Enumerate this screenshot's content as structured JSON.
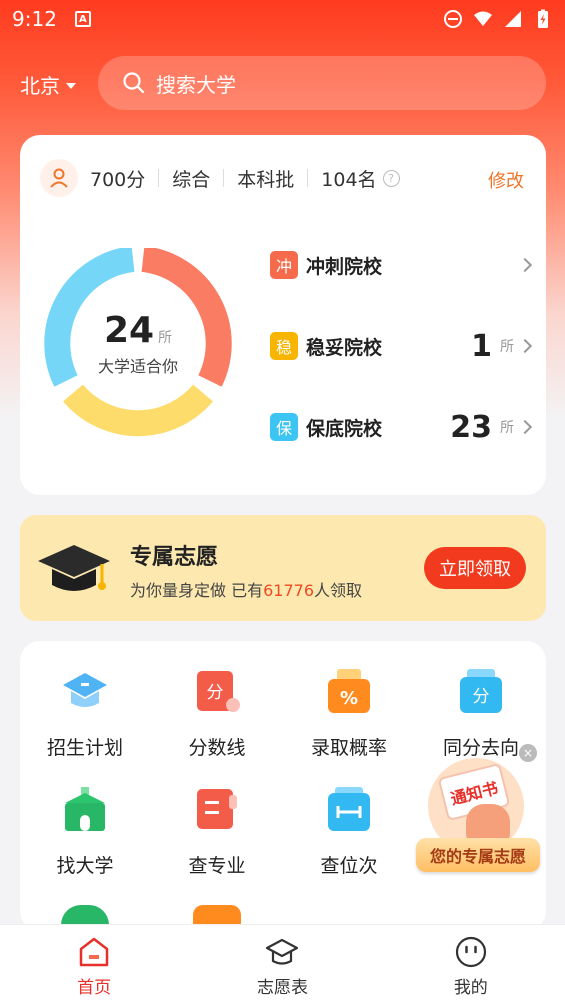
{
  "status_bar": {
    "time": "9:12",
    "a_badge": "A"
  },
  "header": {
    "location": "北京",
    "search_placeholder": "搜索大学"
  },
  "profile": {
    "score": "700分",
    "subject": "综合",
    "batch": "本科批",
    "rank": "104名",
    "help": "?",
    "edit_label": "修改"
  },
  "summary": {
    "total": "24",
    "total_unit": "所",
    "caption": "大学适合你"
  },
  "tiers": [
    {
      "badge": "冲",
      "label": "冲刺院校",
      "count": "",
      "unit": "",
      "color": "#f56b4b"
    },
    {
      "badge": "稳",
      "label": "稳妥院校",
      "count": "1",
      "unit": "所",
      "color": "#f7b500"
    },
    {
      "badge": "保",
      "label": "保底院校",
      "count": "23",
      "unit": "所",
      "color": "#3cc4f2"
    }
  ],
  "donut_colors": {
    "red": "#fa7c63",
    "yellow": "#fddc6b",
    "blue": "#76d6f7"
  },
  "banner": {
    "title": "专属志愿",
    "sub_prefix": "为你量身定做  已有",
    "sub_count": "61776",
    "sub_suffix": "人领取",
    "button": "立即领取"
  },
  "tools": [
    {
      "label": "招生计划",
      "icon": "graduation-cap-icon"
    },
    {
      "label": "分数线",
      "icon": "score-line-icon"
    },
    {
      "label": "录取概率",
      "icon": "percent-basket-icon"
    },
    {
      "label": "同分去向",
      "icon": "same-score-icon"
    },
    {
      "label": "找大学",
      "icon": "university-icon"
    },
    {
      "label": "查专业",
      "icon": "major-book-icon"
    },
    {
      "label": "查位次",
      "icon": "rank-icon"
    }
  ],
  "promo": {
    "card_text": "通知书",
    "label": "您的专属志愿",
    "close": "×"
  },
  "nav": [
    {
      "label": "首页",
      "active": true
    },
    {
      "label": "志愿表",
      "active": false
    },
    {
      "label": "我的",
      "active": false
    }
  ]
}
